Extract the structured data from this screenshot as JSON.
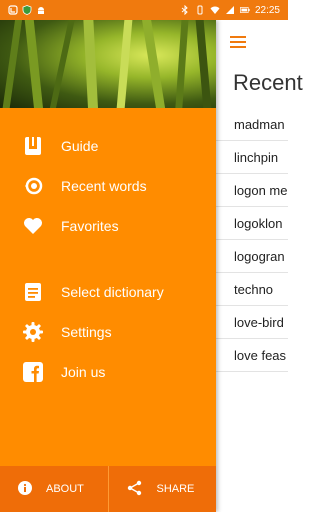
{
  "status_bar": {
    "time": "22:25"
  },
  "content": {
    "title": "Recent",
    "words": [
      "madman",
      "linchpin",
      "logon me",
      "logoklon",
      "logogran",
      "techno",
      "love-bird",
      "love feas"
    ]
  },
  "drawer": {
    "menu": [
      {
        "label": "Guide",
        "icon": "book-icon"
      },
      {
        "label": "Recent words",
        "icon": "history-icon"
      },
      {
        "label": "Favorites",
        "icon": "heart-icon"
      },
      {
        "label": "Select dictionary",
        "icon": "document-icon"
      },
      {
        "label": "Settings",
        "icon": "gear-icon"
      },
      {
        "label": "Join us",
        "icon": "facebook-icon"
      }
    ],
    "bottom": {
      "about_label": "ABOUT",
      "share_label": "SHARE"
    }
  },
  "colors": {
    "accent": "#ff8c00",
    "status_bar": "#f07a0e",
    "bottom_bar": "#ef6d08"
  }
}
